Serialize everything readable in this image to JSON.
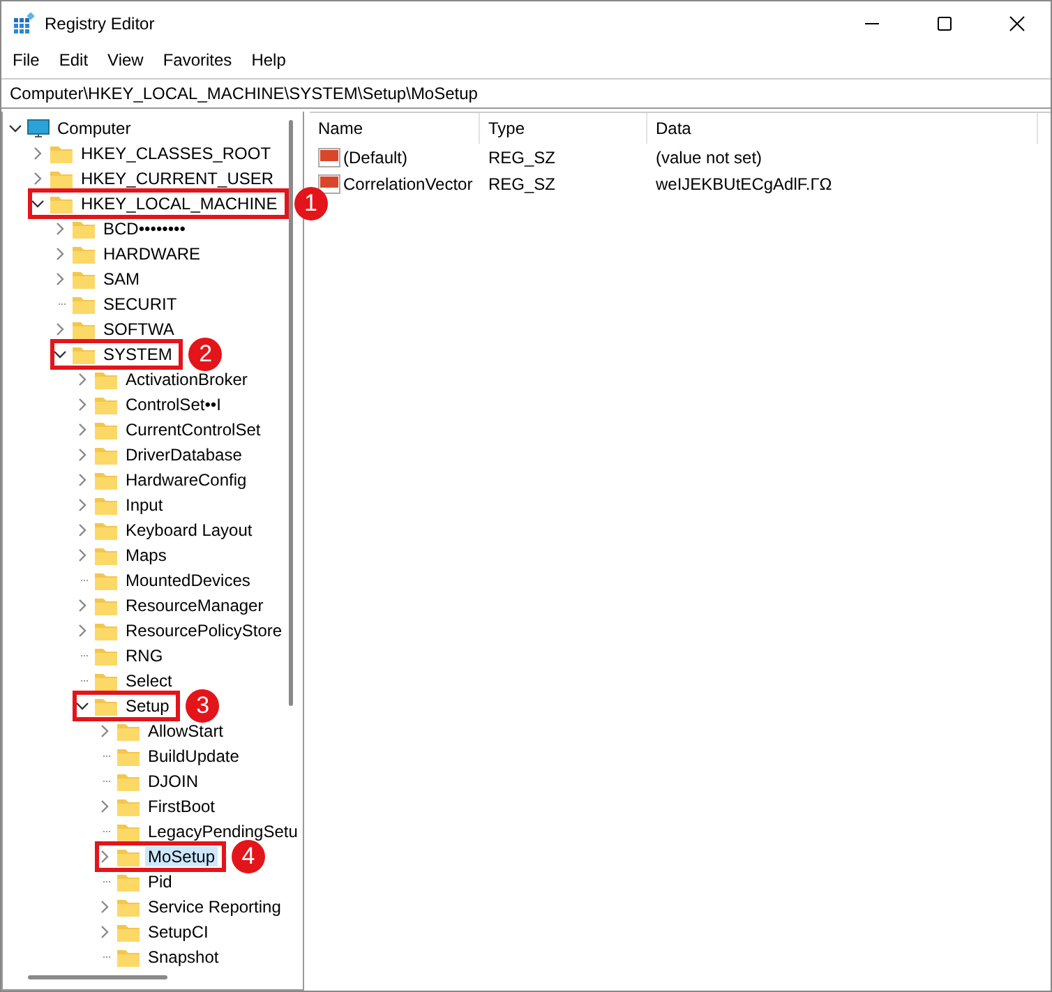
{
  "window": {
    "title": "Registry Editor"
  },
  "menu": [
    "File",
    "Edit",
    "View",
    "Favorites",
    "Help"
  ],
  "address": {
    "value": "Computer\\HKEY_LOCAL_MACHINE\\SYSTEM\\Setup\\MoSetup"
  },
  "tree": [
    {
      "label": "Computer",
      "kind": "branch",
      "expanded": true,
      "selected": false,
      "children": [
        {
          "label": "HKEY_CLASSES_ROOT",
          "kind": "branch",
          "expanded": false,
          "selected": false
        },
        {
          "label": "HKEY_CURRENT_USER",
          "kind": "branch",
          "expanded": false,
          "selected": false
        },
        {
          "label": "HKEY_LOCAL_MACHINE",
          "kind": "branch",
          "expanded": true,
          "selected": false,
          "callout": "1",
          "children": [
            {
              "label": "BCD••••••••",
              "kind": "branch",
              "expanded": false,
              "selected": false
            },
            {
              "label": "HARDWARE",
              "kind": "branch",
              "expanded": false,
              "selected": false
            },
            {
              "label": "SAM",
              "kind": "branch",
              "expanded": false,
              "selected": false
            },
            {
              "label": "SECURIT",
              "kind": "leaf",
              "selected": false
            },
            {
              "label": "SOFTWA",
              "kind": "branch",
              "expanded": false,
              "selected": false
            },
            {
              "label": "SYSTEM",
              "kind": "branch",
              "expanded": true,
              "selected": false,
              "callout": "2",
              "children": [
                {
                  "label": "ActivationBroker",
                  "kind": "branch",
                  "expanded": false,
                  "selected": false
                },
                {
                  "label": "ControlSet••I",
                  "kind": "branch",
                  "expanded": false,
                  "selected": false
                },
                {
                  "label": "CurrentControlSet",
                  "kind": "branch",
                  "expanded": false,
                  "selected": false
                },
                {
                  "label": "DriverDatabase",
                  "kind": "branch",
                  "expanded": false,
                  "selected": false
                },
                {
                  "label": "HardwareConfig",
                  "kind": "branch",
                  "expanded": false,
                  "selected": false
                },
                {
                  "label": "Input",
                  "kind": "branch",
                  "expanded": false,
                  "selected": false
                },
                {
                  "label": "Keyboard Layout",
                  "kind": "branch",
                  "expanded": false,
                  "selected": false
                },
                {
                  "label": "Maps",
                  "kind": "branch",
                  "expanded": false,
                  "selected": false
                },
                {
                  "label": "MountedDevices",
                  "kind": "leaf",
                  "selected": false
                },
                {
                  "label": "ResourceManager",
                  "kind": "branch",
                  "expanded": false,
                  "selected": false
                },
                {
                  "label": "ResourcePolicyStore",
                  "kind": "branch",
                  "expanded": false,
                  "selected": false
                },
                {
                  "label": "RNG",
                  "kind": "leaf",
                  "selected": false
                },
                {
                  "label": "Select",
                  "kind": "leaf",
                  "selected": false
                },
                {
                  "label": "Setup",
                  "kind": "branch",
                  "expanded": true,
                  "selected": false,
                  "callout": "3",
                  "children": [
                    {
                      "label": "AllowStart",
                      "kind": "branch",
                      "expanded": false,
                      "selected": false
                    },
                    {
                      "label": "BuildUpdate",
                      "kind": "leaf",
                      "selected": false
                    },
                    {
                      "label": "DJOIN",
                      "kind": "leaf",
                      "selected": false
                    },
                    {
                      "label": "FirstBoot",
                      "kind": "branch",
                      "expanded": false,
                      "selected": false
                    },
                    {
                      "label": "LegacyPendingSetu",
                      "kind": "leaf",
                      "selected": false
                    },
                    {
                      "label": "MoSetup",
                      "kind": "branch",
                      "expanded": false,
                      "selected": true,
                      "callout": "4"
                    },
                    {
                      "label": "Pid",
                      "kind": "leaf",
                      "selected": false
                    },
                    {
                      "label": "Service Reporting",
                      "kind": "branch",
                      "expanded": false,
                      "selected": false
                    },
                    {
                      "label": "SetupCI",
                      "kind": "branch",
                      "expanded": false,
                      "selected": false
                    },
                    {
                      "label": "Snapshot",
                      "kind": "leaf",
                      "selected": false
                    }
                  ]
                }
              ]
            }
          ]
        }
      ]
    }
  ],
  "values": {
    "columns": [
      "Name",
      "Type",
      "Data"
    ],
    "rows": [
      {
        "name": "(Default)",
        "type": "REG_SZ",
        "data": "(value not set)"
      },
      {
        "name": "CorrelationVector",
        "type": "REG_SZ",
        "data": "weIJEKBUtECgAdlF.ГΩ"
      }
    ]
  }
}
